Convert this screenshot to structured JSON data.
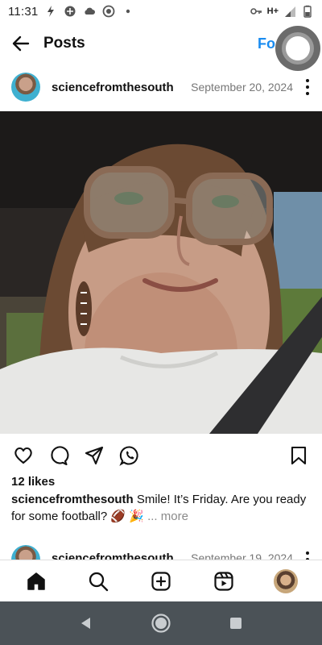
{
  "status_bar": {
    "time": "11:31",
    "network_label": "H+",
    "left_icons": [
      "flash-icon",
      "data-saver-icon",
      "cloud-icon",
      "record-icon",
      "dot-icon"
    ],
    "right_icons": [
      "key-icon",
      "network-icon",
      "signal-icon",
      "battery-icon"
    ]
  },
  "header": {
    "title": "Posts",
    "follow_label": "Fo"
  },
  "post": {
    "username": "sciencefromthesouth",
    "date": "September 20, 2024",
    "likes": "12 likes",
    "caption_user": "sciencefromthesouth",
    "caption_text": " Smile! It’s Friday. Are you ready for some football? 🏈 🎉",
    "caption_more": " ... more",
    "photo_description_icon": "selfie-photo"
  },
  "next_post": {
    "username": "sciencefromthesouth",
    "date": "September 19, 2024"
  },
  "colors": {
    "accent": "#1a8cf0",
    "system_nav": "#4b5257",
    "muted": "#777777"
  }
}
